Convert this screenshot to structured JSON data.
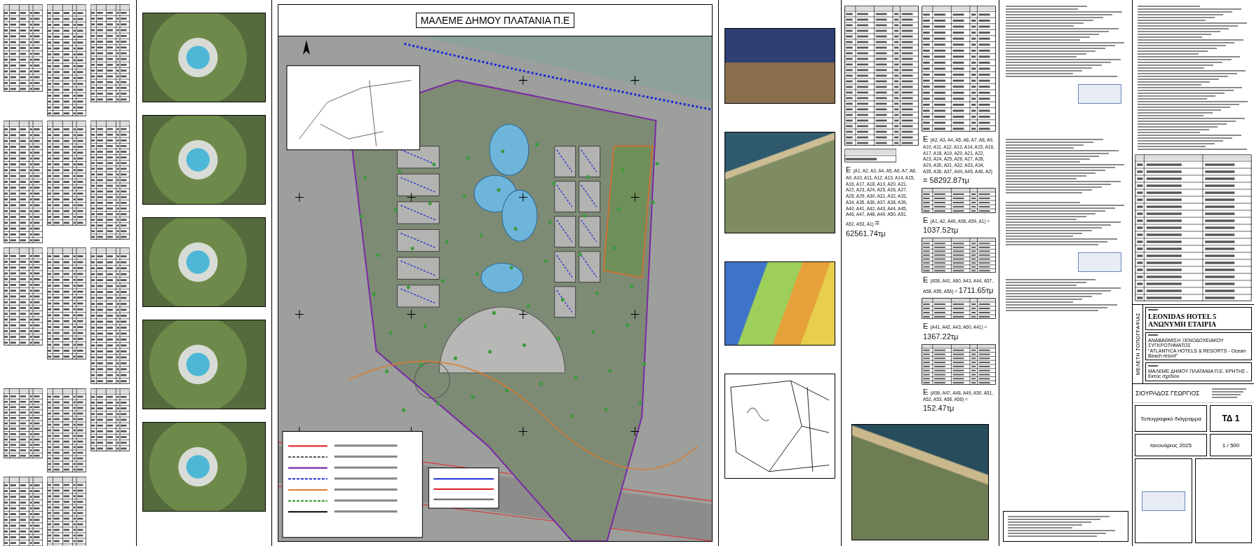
{
  "map": {
    "title": "ΜΑΛΕΜΕ ΔΗΜΟΥ ΠΛΑΤΑΝΙΑ  Π.Ε"
  },
  "area_formulas": [
    {
      "symbol": "Ε",
      "points": "(A1, A2, A3, A4, A5, A6, A7, A8, A9, A10, A11, A12, A13, A14, A15, A16, A17, A18, A19, A20, A21, A22, A23, A24, A25, A26, A27, A28, A29, A30, A31, A32, A33, A34, A35, A36, A37, A38, A39, A40, A41, A42, A43, A44, A45, A46, A47, A48, A49, A50, A51, A52, A53, A1)",
      "value": "= 62561.74τμ"
    },
    {
      "symbol": "Ε",
      "points": "(A2, A3, A4, A5, A6, A7, A8, A9, A10, A11, A12, A13, A14, A15, A16, A17, A18, A19, A20, A21, A22, A23, A24, A25, A26, A27, A28, A29, A30, A31, A32, A33, A34, A35, A36, A37, A44, A45, A46, A2)",
      "value": "= 58292.87τμ"
    },
    {
      "symbol": "Ε",
      "points": "(A1, A2, A46, A56, A59, A1) =",
      "value": "1037.52τμ"
    },
    {
      "symbol": "Ε",
      "points": "(A56, A41, A60, A43, A44, A57, A58, A55, A56) =",
      "value": "1711.65τμ"
    },
    {
      "symbol": "Ε",
      "points": "(A41, A42, A43, A60, A41) =",
      "value": "1367.22τμ"
    },
    {
      "symbol": "Ε",
      "points": "(A56, A47, A48, A49, A50, A51, A52, A53, A58, A56) =",
      "value": "152.47τμ"
    }
  ],
  "title_block": {
    "side_label": "ΜΕΛΕΤΗ ΤΟΠΟΓΡΑΦΙΑΣ",
    "owner": "LEONIDAS HOTEL 5 ΑΝΩΝΥΜΗ ΕΤΑΙΡΙΑ",
    "project": [
      "ΑΝΑΒΑΘΜΙΣΗ ΞΕΝΟΔΟΧΕΙΑΚΟΥ ΣΥΓΚΡΟΤΗΜΑΤΟΣ",
      "\"ATLANTICA HOTELS & RESORTS - Ocean Beach resort\""
    ],
    "location": "ΜΑΛΕΜΕ ΔΗΜΟΥ ΠΛΑΤΑΝΙΑ  Π.Ε. ΚΡΗΤΗΣ - Εκτός σχεδίου",
    "engineer": "ΣΙΟΥΡΑΔΟΣ ΓΕΩΡΓΙΟΣ",
    "drawing_title": "Τοπογραφικό διάγραμμα",
    "drawing_number": "ΤΔ 1",
    "date": "Ιανουάριος 2025",
    "scale": "1 / 500"
  }
}
